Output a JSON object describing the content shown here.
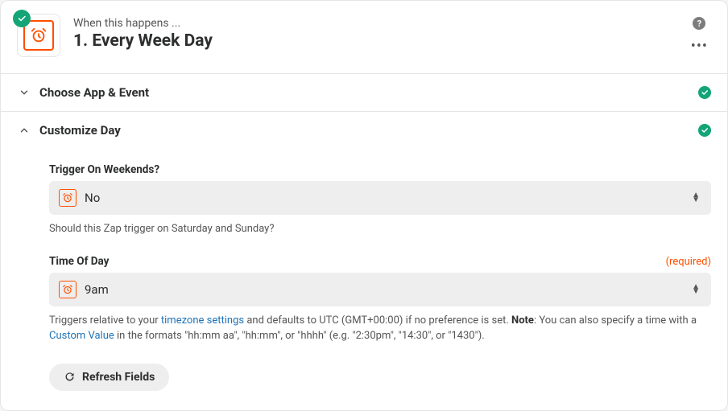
{
  "header": {
    "subtitle": "When this happens ...",
    "title": "1. Every Week Day"
  },
  "sections": {
    "choose": {
      "title": "Choose App & Event"
    },
    "customize": {
      "title": "Customize Day"
    }
  },
  "fields": {
    "weekends": {
      "label": "Trigger On Weekends?",
      "value": "No",
      "help": "Should this Zap trigger on Saturday and Sunday?"
    },
    "time": {
      "label": "Time Of Day",
      "required_text": "(required)",
      "value": "9am",
      "help_pre": "Triggers relative to your ",
      "help_link1": "timezone settings",
      "help_mid": " and defaults to UTC (GMT+00:00) if no preference is set. ",
      "help_note_label": "Note",
      "help_note_text": ": You can also specify a time with a ",
      "help_link2": "Custom Value",
      "help_post": " in the formats \"hh:mm aa\", \"hh:mm\", or \"hhhh\" (e.g. \"2:30pm\", \"14:30\", or \"1430\")."
    }
  },
  "buttons": {
    "refresh": "Refresh Fields"
  }
}
